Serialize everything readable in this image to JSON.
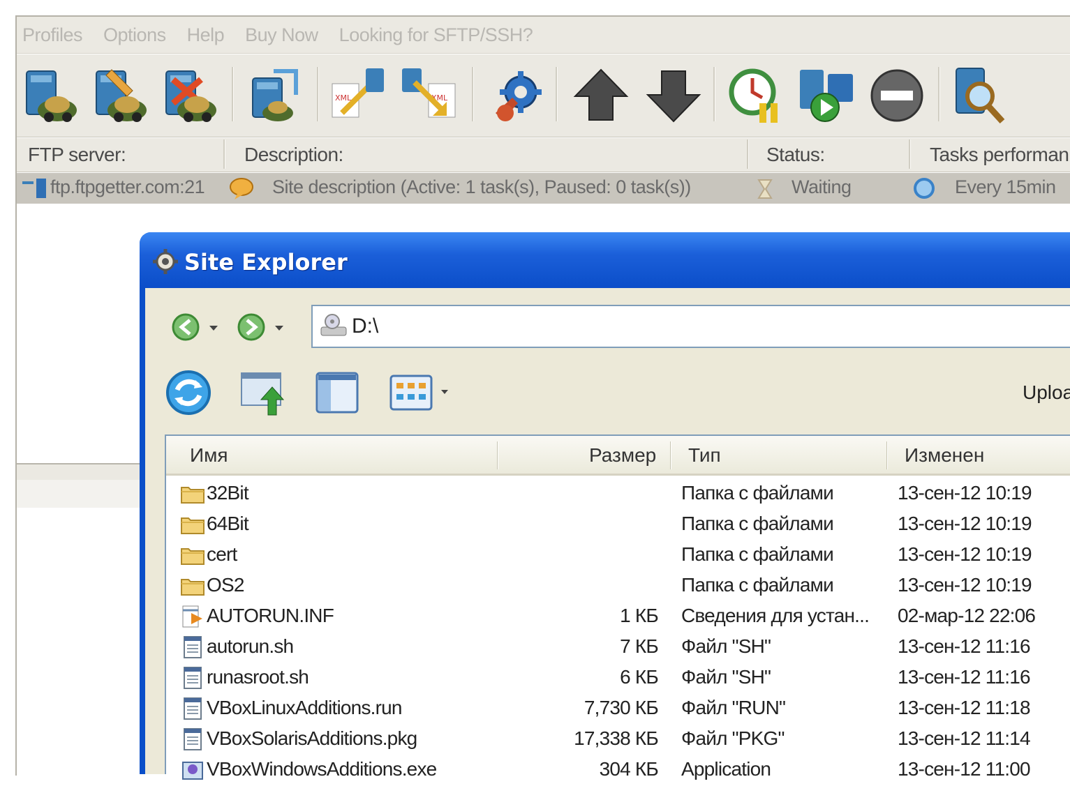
{
  "menu": {
    "items": [
      "Profiles",
      "Options",
      "Help",
      "Buy Now",
      "Looking for SFTP/SSH?"
    ]
  },
  "toolbar": {
    "buttons": [
      "new-profile",
      "edit-profile",
      "delete-profile",
      "connect",
      "import-xml",
      "export-xml",
      "settings",
      "move-up",
      "move-down",
      "scheduler",
      "run",
      "stop",
      "search"
    ]
  },
  "columns": {
    "ftp_server": "FTP server:",
    "description": "Description:",
    "status": "Status:",
    "tasks": "Tasks performan"
  },
  "site_row": {
    "server": "ftp.ftpgetter.com:21",
    "description": "Site description (Active: 1 task(s), Paused: 0 task(s))",
    "status": "Waiting",
    "tasks": "Every 15min"
  },
  "site_explorer": {
    "title": "Site Explorer",
    "address": "D:\\",
    "upload_label": "Upload",
    "list_headers": {
      "name": "Имя",
      "size": "Размер",
      "type": "Тип",
      "modified": "Изменен"
    },
    "files": [
      {
        "name": "32Bit",
        "size": "",
        "type": "Папка с файлами",
        "modified": "13-сен-12 10:19",
        "icon": "folder-icon"
      },
      {
        "name": "64Bit",
        "size": "",
        "type": "Папка с файлами",
        "modified": "13-сен-12 10:19",
        "icon": "folder-icon"
      },
      {
        "name": "cert",
        "size": "",
        "type": "Папка с файлами",
        "modified": "13-сен-12 10:19",
        "icon": "folder-icon"
      },
      {
        "name": "OS2",
        "size": "",
        "type": "Папка с файлами",
        "modified": "13-сен-12 10:19",
        "icon": "folder-icon"
      },
      {
        "name": "AUTORUN.INF",
        "size": "1 КБ",
        "type": "Сведения для устан...",
        "modified": "02-мар-12 22:06",
        "icon": "setup-info-icon"
      },
      {
        "name": "autorun.sh",
        "size": "7 КБ",
        "type": "Файл \"SH\"",
        "modified": "13-сен-12 11:16",
        "icon": "file-icon"
      },
      {
        "name": "runasroot.sh",
        "size": "6 КБ",
        "type": "Файл \"SH\"",
        "modified": "13-сен-12 11:16",
        "icon": "file-icon"
      },
      {
        "name": "VBoxLinuxAdditions.run",
        "size": "7,730 КБ",
        "type": "Файл \"RUN\"",
        "modified": "13-сен-12 11:18",
        "icon": "file-icon"
      },
      {
        "name": "VBoxSolarisAdditions.pkg",
        "size": "17,338 КБ",
        "type": "Файл \"PKG\"",
        "modified": "13-сен-12 11:14",
        "icon": "file-icon"
      },
      {
        "name": "VBoxWindowsAdditions.exe",
        "size": "304 КБ",
        "type": "Application",
        "modified": "13-сен-12 11:00",
        "icon": "application-icon"
      }
    ]
  },
  "colors": {
    "xp_blue": "#0b4ec9",
    "toolbar_bg": "#ebe9e2",
    "selected_row": "#c8c5bd"
  }
}
